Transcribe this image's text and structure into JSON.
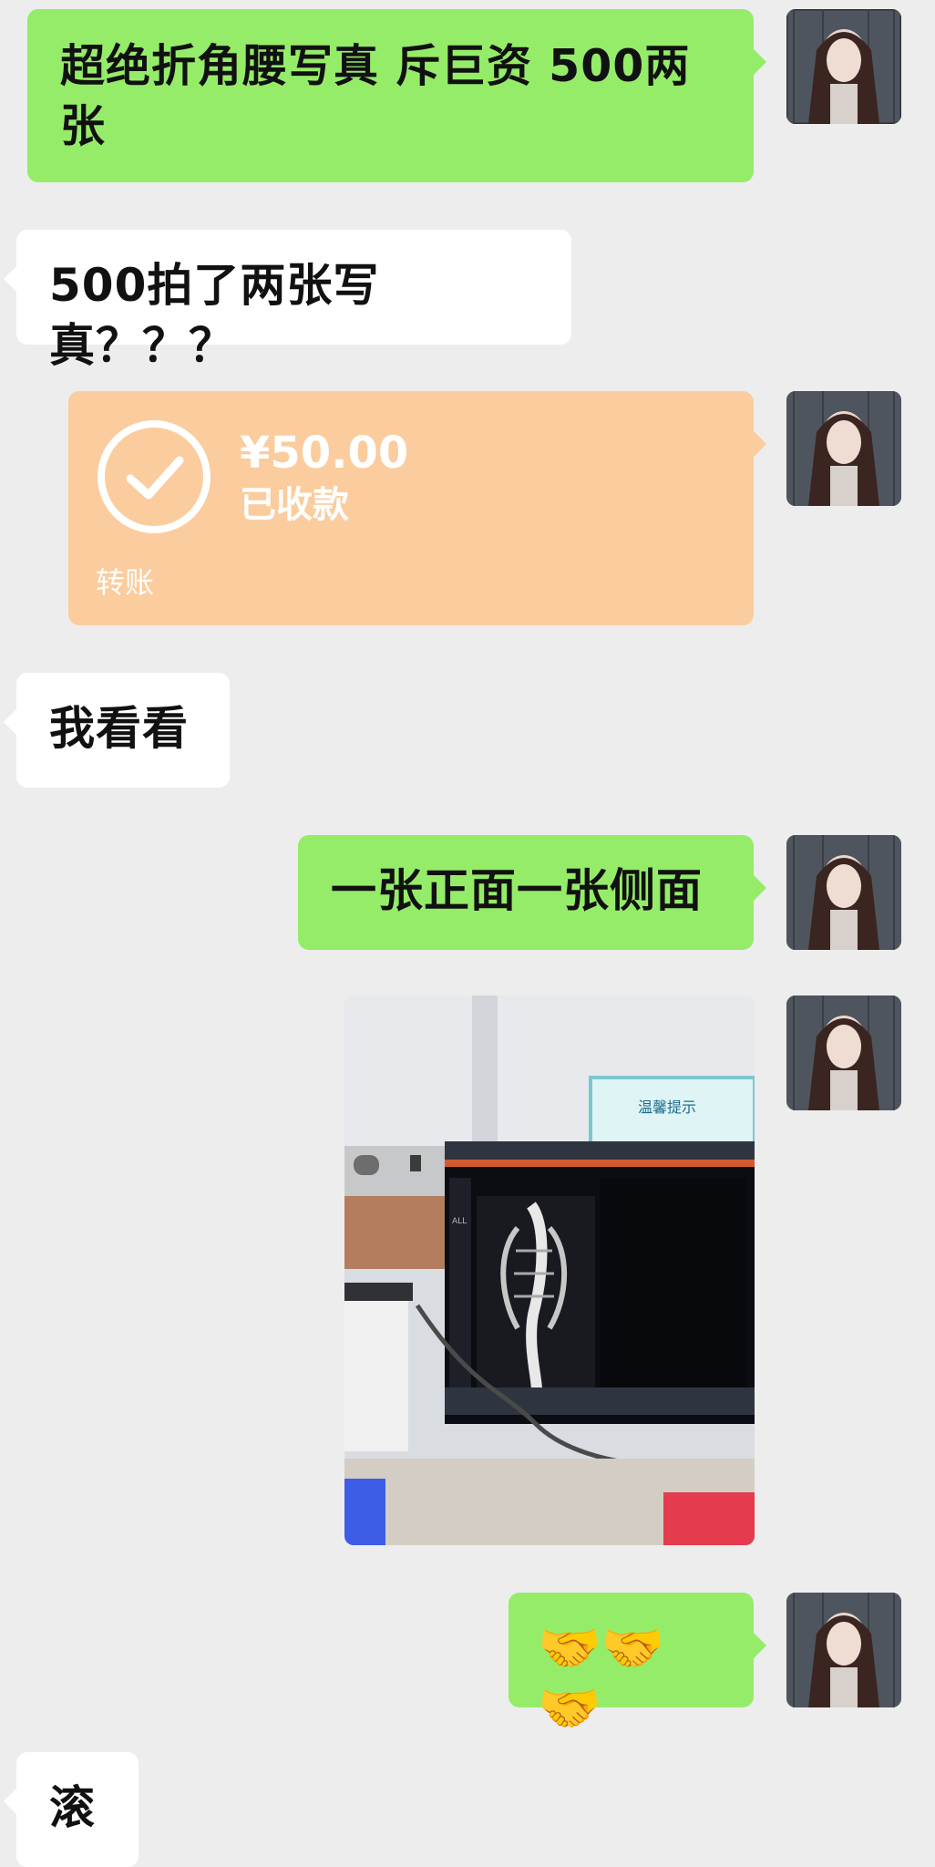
{
  "messages": [
    {
      "id": "m1",
      "side": "right",
      "type": "text",
      "text": "超绝折角腰写真 斥巨资 500两张"
    },
    {
      "id": "m2",
      "side": "left",
      "type": "text",
      "text": "500拍了两张写真？？？"
    },
    {
      "id": "m3",
      "side": "right",
      "type": "transfer",
      "amount": "¥50.00",
      "status": "已收款",
      "label": "转账"
    },
    {
      "id": "m4",
      "side": "left",
      "type": "text",
      "text": "我看看"
    },
    {
      "id": "m5",
      "side": "right",
      "type": "text",
      "text": "一张正面一张侧面"
    },
    {
      "id": "m6",
      "side": "right",
      "type": "image",
      "sign_text": "温馨提示",
      "screen_text": "ALL"
    },
    {
      "id": "m7",
      "side": "right",
      "type": "text",
      "text": "🤝🤝🤝"
    },
    {
      "id": "m8",
      "side": "left",
      "type": "text",
      "text": "滚"
    }
  ],
  "colors": {
    "background": "#ededed",
    "self_bubble": "#95ec69",
    "other_bubble": "#ffffff",
    "transfer_bubble": "#fbcc9d"
  },
  "icons": {
    "transfer_status": "check-circle-icon"
  }
}
